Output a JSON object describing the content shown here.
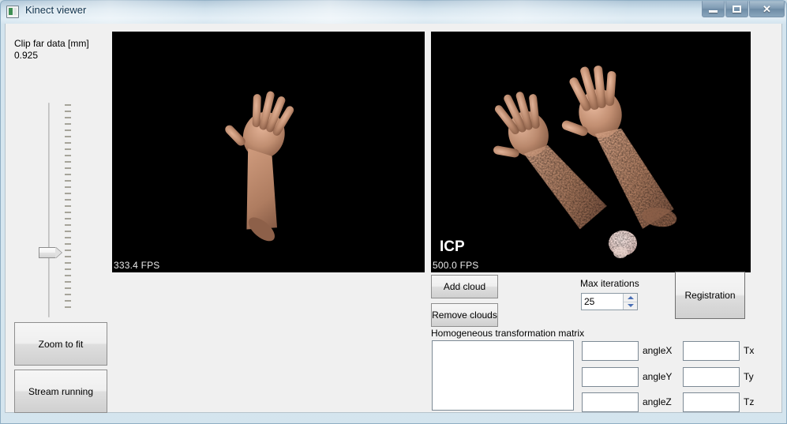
{
  "window": {
    "title": "Kinect viewer",
    "icon": "app-icon",
    "caption_buttons": {
      "minimize": "minimize-icon",
      "maximize": "maximize-icon",
      "close": "✕"
    }
  },
  "left_panel": {
    "clip_label": "Clip far data [mm]",
    "clip_value": "0.925",
    "slider": {
      "name": "clip-far-slider",
      "orientation": "vertical",
      "thumb_position_pct": 67,
      "tick_count": 33
    },
    "buttons": [
      {
        "name": "zoom-to-fit-button",
        "label": "Zoom to fit"
      },
      {
        "name": "stream-running-button",
        "label": "Stream running"
      }
    ]
  },
  "viewports": {
    "left": {
      "name": "depth-stream-viewport",
      "fps": "333.4 FPS",
      "background": "#000000"
    },
    "right": {
      "name": "icp-result-viewport",
      "title": "ICP",
      "fps": "500.0 FPS",
      "background": "#000000"
    }
  },
  "controls": {
    "add_cloud": "Add cloud",
    "remove_clouds": "Remove clouds",
    "max_iterations_label": "Max iterations",
    "max_iterations_value": "25",
    "registration": "Registration",
    "matrix_label": "Homogeneous transformation matrix",
    "matrix_value": "",
    "rows": [
      {
        "angle_label": "angleX",
        "angle_value": "",
        "t_label": "Tx",
        "t_value": ""
      },
      {
        "angle_label": "angleY",
        "angle_value": "",
        "t_label": "Ty",
        "t_value": ""
      },
      {
        "angle_label": "angleZ",
        "angle_value": "",
        "t_label": "Tz",
        "t_value": ""
      }
    ]
  },
  "colors": {
    "window_background": "#f0f0f0",
    "viewport_background": "#000000",
    "title_text": "#10334d",
    "skin_light": "#d9a58b",
    "skin_mid": "#b07e63",
    "skin_dark": "#7c5240"
  }
}
